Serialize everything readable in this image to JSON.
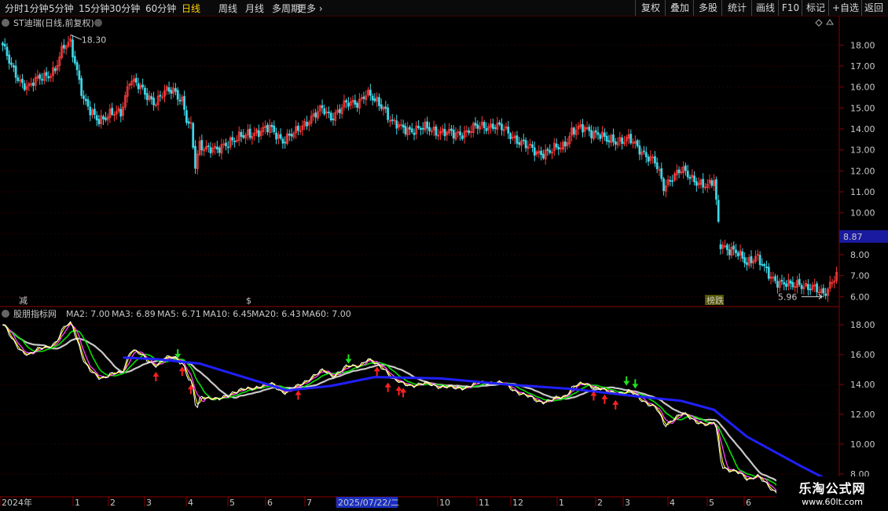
{
  "toolbar": {
    "periods": [
      "分时",
      "1分钟",
      "5分钟",
      "15分钟",
      "30分钟",
      "60分钟",
      "日线",
      "周线",
      "月线",
      "多周期",
      "更多"
    ],
    "active": "日线",
    "buttons": [
      "复权",
      "叠加",
      "多股",
      "统计",
      "画线",
      "F10",
      "标记",
      "+自选",
      "返回"
    ]
  },
  "colors": {
    "up": "#ff3b3b",
    "down": "#3fd6e6",
    "ma2": "#ffffff",
    "ma3": "#ffff00",
    "ma5": "#ff40ff",
    "ma10": "#00e000",
    "ma20": "#c8c8c8",
    "ma60": "#2020ff",
    "axis": "#8b0000"
  },
  "main_panel": {
    "title": "ST迪瑞(日线,前复权)",
    "high_label": "18.30",
    "low_label": "5.96",
    "price_box": "8.87",
    "markers": [
      "减",
      "$",
      "榜跌"
    ]
  },
  "indicator_panel": {
    "name": "股朋指标网",
    "legend": [
      {
        "key": "ma2",
        "label": "MA2: 7.00"
      },
      {
        "key": "ma3",
        "label": "MA3: 6.89"
      },
      {
        "key": "ma5",
        "label": "MA5: 6.71"
      },
      {
        "key": "ma10",
        "label": "MA10: 6.45"
      },
      {
        "key": "ma20",
        "label": "MA20: 6.43"
      },
      {
        "key": "ma60",
        "label": "MA60: 7.00"
      }
    ]
  },
  "chart_data": {
    "type": "candlestick",
    "price_ticks": [
      "18.00",
      "17.00",
      "16.00",
      "15.00",
      "14.00",
      "13.00",
      "12.00",
      "11.00",
      "10.00",
      "9.00",
      "8.00",
      "7.00",
      "6.00"
    ],
    "ylim": [
      5.6,
      18.8
    ],
    "indicator_ticks": [
      "18.00",
      "16.00",
      "14.00",
      "12.00",
      "10.00",
      "8.00"
    ],
    "indicator_ylim": [
      7.2,
      18.8
    ],
    "x_ticks": [
      "2024年",
      "1",
      "2",
      "3",
      "4",
      "5",
      "6",
      "7",
      "2025/07/22/二",
      "10",
      "11",
      "12",
      "1",
      "2",
      "3",
      "4",
      "5",
      "6"
    ],
    "close_path": [
      [
        0,
        18.0
      ],
      [
        4,
        16.9
      ],
      [
        8,
        16.3
      ],
      [
        12,
        16.0
      ],
      [
        18,
        16.5
      ],
      [
        24,
        16.8
      ],
      [
        28,
        17.9
      ],
      [
        31,
        18.2
      ],
      [
        34,
        16.8
      ],
      [
        37,
        15.3
      ],
      [
        40,
        14.8
      ],
      [
        44,
        14.5
      ],
      [
        48,
        14.6
      ],
      [
        54,
        14.8
      ],
      [
        58,
        16.4
      ],
      [
        62,
        16.0
      ],
      [
        66,
        15.6
      ],
      [
        70,
        15.3
      ],
      [
        74,
        15.7
      ],
      [
        78,
        15.9
      ],
      [
        82,
        15.4
      ],
      [
        84,
        14.4
      ],
      [
        86,
        14.0
      ],
      [
        88,
        12.2
      ],
      [
        90,
        13.3
      ],
      [
        94,
        13.1
      ],
      [
        98,
        12.9
      ],
      [
        104,
        13.5
      ],
      [
        110,
        13.6
      ],
      [
        116,
        13.9
      ],
      [
        122,
        14.0
      ],
      [
        128,
        13.5
      ],
      [
        134,
        13.8
      ],
      [
        140,
        14.5
      ],
      [
        146,
        14.9
      ],
      [
        150,
        14.6
      ],
      [
        156,
        15.1
      ],
      [
        162,
        15.3
      ],
      [
        166,
        15.7
      ],
      [
        170,
        15.3
      ],
      [
        174,
        15.1
      ],
      [
        178,
        14.3
      ],
      [
        182,
        14.0
      ],
      [
        188,
        14.0
      ],
      [
        194,
        14.0
      ],
      [
        200,
        13.9
      ],
      [
        206,
        13.7
      ],
      [
        212,
        13.9
      ],
      [
        218,
        14.1
      ],
      [
        224,
        14.2
      ],
      [
        228,
        14.0
      ],
      [
        234,
        13.6
      ],
      [
        240,
        13.1
      ],
      [
        244,
        12.9
      ],
      [
        250,
        12.9
      ],
      [
        256,
        13.2
      ],
      [
        260,
        13.9
      ],
      [
        266,
        14.0
      ],
      [
        272,
        13.8
      ],
      [
        276,
        13.4
      ],
      [
        282,
        13.5
      ],
      [
        286,
        13.5
      ],
      [
        290,
        13.1
      ],
      [
        294,
        12.8
      ],
      [
        298,
        12.4
      ],
      [
        302,
        11.2
      ],
      [
        306,
        11.8
      ],
      [
        310,
        12.0
      ],
      [
        314,
        11.7
      ],
      [
        318,
        11.5
      ],
      [
        322,
        11.2
      ],
      [
        325,
        11.5
      ],
      [
        328,
        8.6
      ],
      [
        332,
        8.2
      ],
      [
        336,
        8.0
      ],
      [
        340,
        7.7
      ],
      [
        344,
        7.9
      ],
      [
        348,
        7.3
      ],
      [
        352,
        6.9
      ],
      [
        356,
        6.6
      ],
      [
        360,
        6.5
      ],
      [
        364,
        6.7
      ],
      [
        368,
        6.4
      ],
      [
        372,
        6.3
      ],
      [
        375,
        6.2
      ],
      [
        378,
        6.6
      ],
      [
        381,
        7.0
      ]
    ],
    "gap_index": 328,
    "ma60_path": [
      [
        55,
        15.8
      ],
      [
        70,
        15.7
      ],
      [
        90,
        15.4
      ],
      [
        110,
        14.5
      ],
      [
        130,
        13.6
      ],
      [
        150,
        13.9
      ],
      [
        170,
        14.5
      ],
      [
        200,
        14.4
      ],
      [
        230,
        14.0
      ],
      [
        260,
        13.7
      ],
      [
        290,
        13.2
      ],
      [
        310,
        12.9
      ],
      [
        325,
        12.3
      ],
      [
        340,
        10.5
      ],
      [
        365,
        8.5
      ],
      [
        381,
        7.3
      ]
    ],
    "up_arrows": [
      70,
      82,
      86,
      135,
      171,
      176,
      181,
      183,
      270,
      275,
      280
    ],
    "down_arrows": [
      80,
      158,
      285,
      289
    ]
  }
}
